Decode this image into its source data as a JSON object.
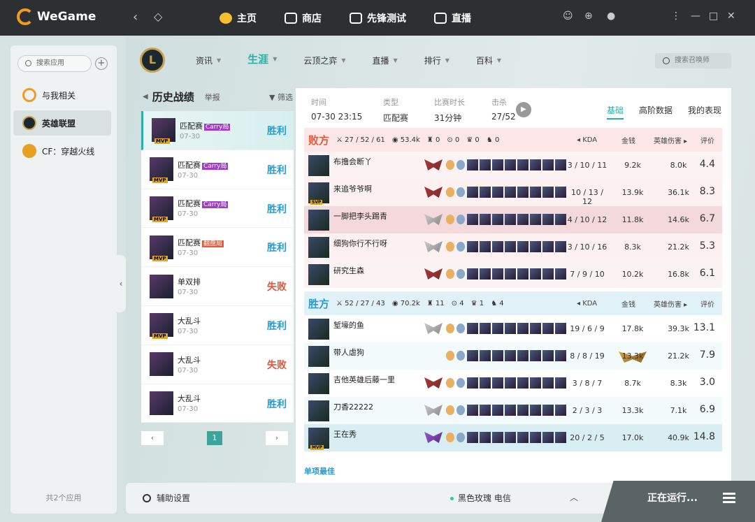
{
  "app": {
    "name": "WeGame"
  },
  "nav": [
    {
      "label": "主页"
    },
    {
      "label": "商店"
    },
    {
      "label": "先锋测试"
    },
    {
      "label": "直播"
    }
  ],
  "sidebar": {
    "search_placeholder": "搜索应用",
    "items": [
      {
        "label": "与我相关"
      },
      {
        "label": "英雄联盟"
      },
      {
        "label": "CF：穿越火线"
      }
    ],
    "footer": "共2个应用"
  },
  "game": {
    "logo": "L",
    "subnav": [
      {
        "label": "资讯"
      },
      {
        "label": "生涯"
      },
      {
        "label": "云顶之弈"
      },
      {
        "label": "直播"
      },
      {
        "label": "排行"
      },
      {
        "label": "百科"
      }
    ],
    "summoner_search": "搜索召唤师"
  },
  "history": {
    "title": "历史战绩",
    "report": "举报",
    "filter": "筛选",
    "page": "1",
    "matches": [
      {
        "mode": "匹配赛",
        "tag": "Carry局",
        "tag_color": "#a03cc8",
        "date": "07-30",
        "result": "胜利",
        "mvp": "MVP"
      },
      {
        "mode": "匹配赛",
        "tag": "Carry局",
        "tag_color": "#a03cc8",
        "date": "07-30",
        "result": "胜利",
        "mvp": "MVP"
      },
      {
        "mode": "匹配赛",
        "tag": "Carry局",
        "tag_color": "#a03cc8",
        "date": "07-30",
        "result": "胜利",
        "mvp": "MVP"
      },
      {
        "mode": "匹配赛",
        "tag": "翻盘局",
        "tag_color": "#e85a3a",
        "date": "07-30",
        "result": "胜利",
        "mvp": "MVP"
      },
      {
        "mode": "单双排",
        "tag": "",
        "tag_color": "",
        "date": "07-30",
        "result": "失败",
        "mvp": ""
      },
      {
        "mode": "大乱斗",
        "tag": "",
        "tag_color": "",
        "date": "07-30",
        "result": "胜利",
        "mvp": "MVP"
      },
      {
        "mode": "大乱斗",
        "tag": "",
        "tag_color": "",
        "date": "07-30",
        "result": "失败",
        "mvp": ""
      },
      {
        "mode": "大乱斗",
        "tag": "",
        "tag_color": "",
        "date": "07-30",
        "result": "胜利",
        "mvp": ""
      }
    ]
  },
  "detail": {
    "info": [
      {
        "label": "时间",
        "value": "07-30 23:15"
      },
      {
        "label": "类型",
        "value": "匹配赛"
      },
      {
        "label": "比赛时长",
        "value": "31分钟"
      },
      {
        "label": "击杀",
        "value": "27/52"
      }
    ],
    "tabs": [
      {
        "label": "基础"
      },
      {
        "label": "高阶数据"
      },
      {
        "label": "我的表现"
      }
    ],
    "cols": {
      "kda": "KDA",
      "gold": "金钱",
      "dmg": "英雄伤害",
      "score": "评价"
    },
    "teams": [
      {
        "name": "败方",
        "color": "#e05a3a",
        "bg": "#fbe7e7",
        "kills": "27 / 52 / 61",
        "gold": "53.4k",
        "t1": "0",
        "t2": "0",
        "t3": "0",
        "t4": "0",
        "players": [
          {
            "name": "布撸会断丫",
            "badge": "",
            "rank": "",
            "kda": "3 / 10 / 11",
            "gold": "9.2k",
            "dmg": "8.0k",
            "score": "4.4"
          },
          {
            "name": "来追爷爷啊",
            "badge": "SVP",
            "rank": "",
            "kda": "10 / 13 / 12",
            "gold": "13.9k",
            "dmg": "36.1k",
            "score": "8.3"
          },
          {
            "name": "一脚把李头踢青",
            "badge": "",
            "rank": "silver",
            "kda": "4 / 10 / 12",
            "gold": "11.8k",
            "dmg": "14.6k",
            "score": "6.7"
          },
          {
            "name": "细狗你行不行呀",
            "badge": "",
            "rank": "silver",
            "kda": "3 / 10 / 16",
            "gold": "8.3k",
            "dmg": "21.2k",
            "score": "5.3"
          },
          {
            "name": "研究生森",
            "badge": "",
            "rank": "",
            "kda": "7 / 9 / 10",
            "gold": "10.2k",
            "dmg": "16.8k",
            "score": "6.1"
          }
        ]
      },
      {
        "name": "胜方",
        "color": "#2a9ad0",
        "bg": "#e1f1f8",
        "kills": "52 / 27 / 43",
        "gold": "70.2k",
        "t1": "11",
        "t2": "4",
        "t3": "1",
        "t4": "4",
        "players": [
          {
            "name": "堑壕的鱼",
            "badge": "",
            "rank": "silver",
            "kda": "19 / 6 / 9",
            "gold": "17.8k",
            "dmg": "39.3k",
            "score": "13.1"
          },
          {
            "name": "带人虐狗",
            "badge": "",
            "rank": "gold",
            "kda": "8 / 8 / 19",
            "gold": "13.3k",
            "dmg": "21.2k",
            "score": "7.9"
          },
          {
            "name": "吉他英雄后藤一里",
            "badge": "",
            "rank": "",
            "kda": "3 / 8 / 7",
            "gold": "8.7k",
            "dmg": "8.3k",
            "score": "3.0"
          },
          {
            "name": "刀香22222",
            "badge": "",
            "rank": "silver",
            "kda": "2 / 3 / 3",
            "gold": "13.3k",
            "dmg": "7.1k",
            "score": "6.9"
          },
          {
            "name": "王在秀",
            "badge": "MVP",
            "rank": "purple",
            "kda": "20 / 2 / 5",
            "gold": "17.0k",
            "dmg": "40.9k",
            "score": "14.8"
          }
        ]
      }
    ],
    "best_label": "单项最佳"
  },
  "footer": {
    "aux": "辅助设置",
    "server": "黑色玫瑰 电信",
    "running": "正在运行..."
  }
}
